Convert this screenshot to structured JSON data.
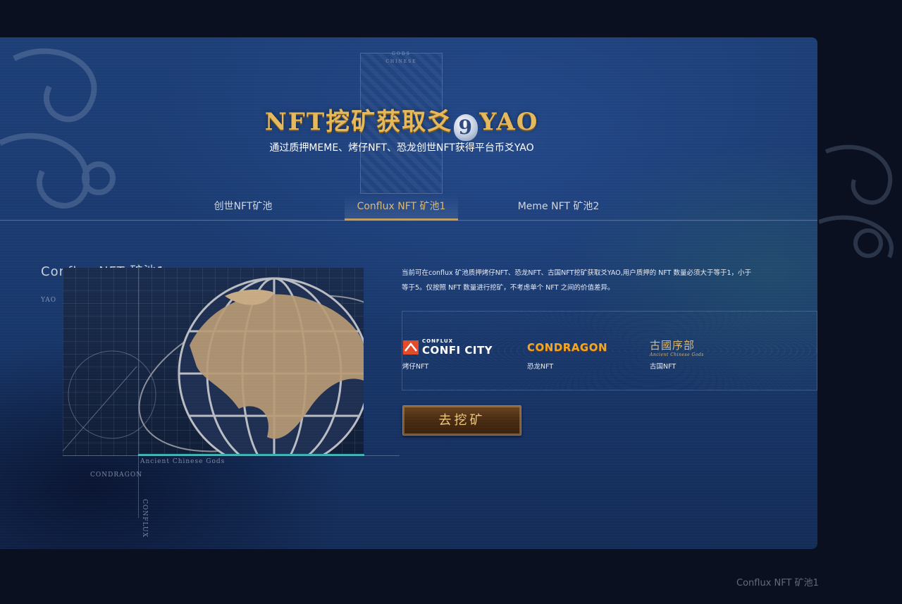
{
  "hero": {
    "title_left": "NFT挖矿获取爻",
    "title_nine": "9",
    "title_right": "YAO",
    "subtitle": "通过质押MEME、烤仔NFT、恐龙创世NFT获得平台币爻YAO",
    "plaque_top": "GODS",
    "plaque_sub": "CHINESE"
  },
  "tabs": [
    {
      "label": "创世NFT矿池",
      "active": false
    },
    {
      "label": "Conflux NFT 矿池1",
      "active": true
    },
    {
      "label": "Meme NFT 矿池2",
      "active": false
    }
  ],
  "pool": {
    "label": "Conflux NFT 矿池1",
    "axis_yao": "YAO",
    "axis_gods": "Ancient Chinese Gods",
    "axis_condragon": "CONDRAGON",
    "axis_conflux": "CONFLUX",
    "description": "当前可在conflux 矿池质押烤仔NFT、恐龙NFT、古国NFT挖矿获取爻YAO,用户质押的 NFT 数量必须大于等于1，小于等于5。仅按照 NFT 数量进行挖矿，不考虑单个 NFT 之间的价值差异。",
    "partners": [
      {
        "logo_small": "CONFLUX",
        "logo_main": "CONFI CITY",
        "name": "烤仔NFT"
      },
      {
        "logo_main": "CONDRAGON",
        "name": "恐龙NFT"
      },
      {
        "logo_main": "古國序部",
        "logo_small": "Ancient Chinese Gods",
        "name": "古国NFT"
      }
    ],
    "button_label": "去挖矿"
  },
  "footer": {
    "label": "Conflux NFT 矿池1"
  },
  "colors": {
    "gold": "#e6b85c",
    "accent_teal": "#2fb3b0",
    "tab_active": "#c79b52"
  }
}
